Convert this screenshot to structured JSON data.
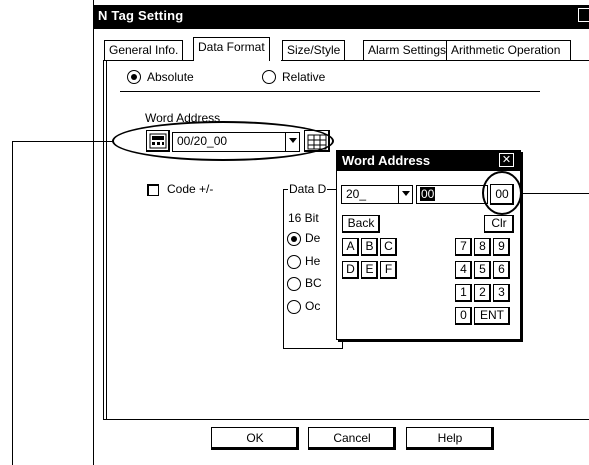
{
  "window": {
    "title": "N Tag Setting"
  },
  "tabs": [
    {
      "label": "General Info."
    },
    {
      "label": "Data Format"
    },
    {
      "label": "Size/Style"
    },
    {
      "label": "Alarm Settings"
    },
    {
      "label": "Arithmetic Operation"
    }
  ],
  "addressing": {
    "absolute_label": "Absolute",
    "relative_label": "Relative",
    "selected": "Absolute"
  },
  "word_address": {
    "label": "Word Address",
    "value": "00/20_00"
  },
  "code_checkbox": {
    "label": "Code +/-"
  },
  "data_group": {
    "title": "Data D",
    "bits_label": "16 Bit",
    "options": [
      "De",
      "He",
      "BC",
      "Oc"
    ],
    "selected": "De"
  },
  "dialog": {
    "title": "Word Address",
    "close_glyph": "✕",
    "combo_value": "20_",
    "field_value": "00",
    "side_value": "00",
    "back_label": "Back",
    "clr_label": "Clr",
    "letters_row1": [
      "A",
      "B",
      "C"
    ],
    "letters_row2": [
      "D",
      "E",
      "F"
    ],
    "digits_row1": [
      "7",
      "8",
      "9"
    ],
    "digits_row2": [
      "4",
      "5",
      "6"
    ],
    "digits_row3": [
      "1",
      "2",
      "3"
    ],
    "zero_label": "0",
    "ent_label": "ENT"
  },
  "footer": {
    "ok_label": "OK",
    "cancel_label": "Cancel",
    "help_label": "Help"
  }
}
